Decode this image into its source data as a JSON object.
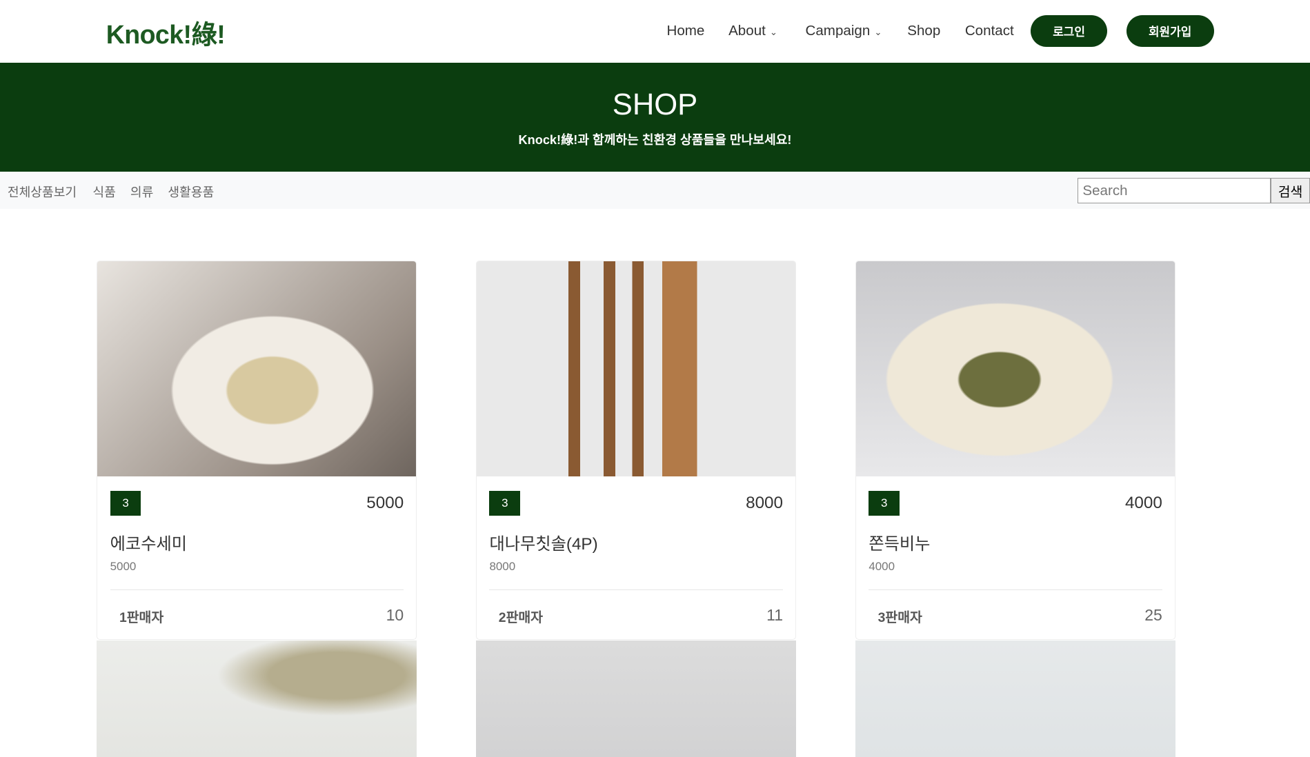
{
  "nav": {
    "logo": "Knock!綠!",
    "items": [
      {
        "label": "Home"
      },
      {
        "label": "About",
        "chev": "⌄"
      },
      {
        "label": "Campaign",
        "chev": "⌄"
      },
      {
        "label": "Shop"
      },
      {
        "label": "Contact"
      }
    ],
    "login": "로그인",
    "signup": "회원가입"
  },
  "banner": {
    "title": "SHOP",
    "subtitle": "Knock!綠!과 함께하는 친환경 상품들을 만나보세요!"
  },
  "categories": [
    "전체상품보기",
    "식품",
    "의류",
    "생활용품"
  ],
  "search": {
    "placeholder": "Search",
    "button": "검색"
  },
  "products": [
    {
      "badge": "3",
      "price": "5000",
      "name": "에코수세미",
      "sub_price": "5000",
      "seller": "1판매자",
      "count": "10"
    },
    {
      "badge": "3",
      "price": "8000",
      "name": "대나무칫솔(4P)",
      "sub_price": "8000",
      "seller": "2판매자",
      "count": "11"
    },
    {
      "badge": "3",
      "price": "4000",
      "name": "쫀득비누",
      "sub_price": "4000",
      "seller": "3판매자",
      "count": "25"
    }
  ]
}
